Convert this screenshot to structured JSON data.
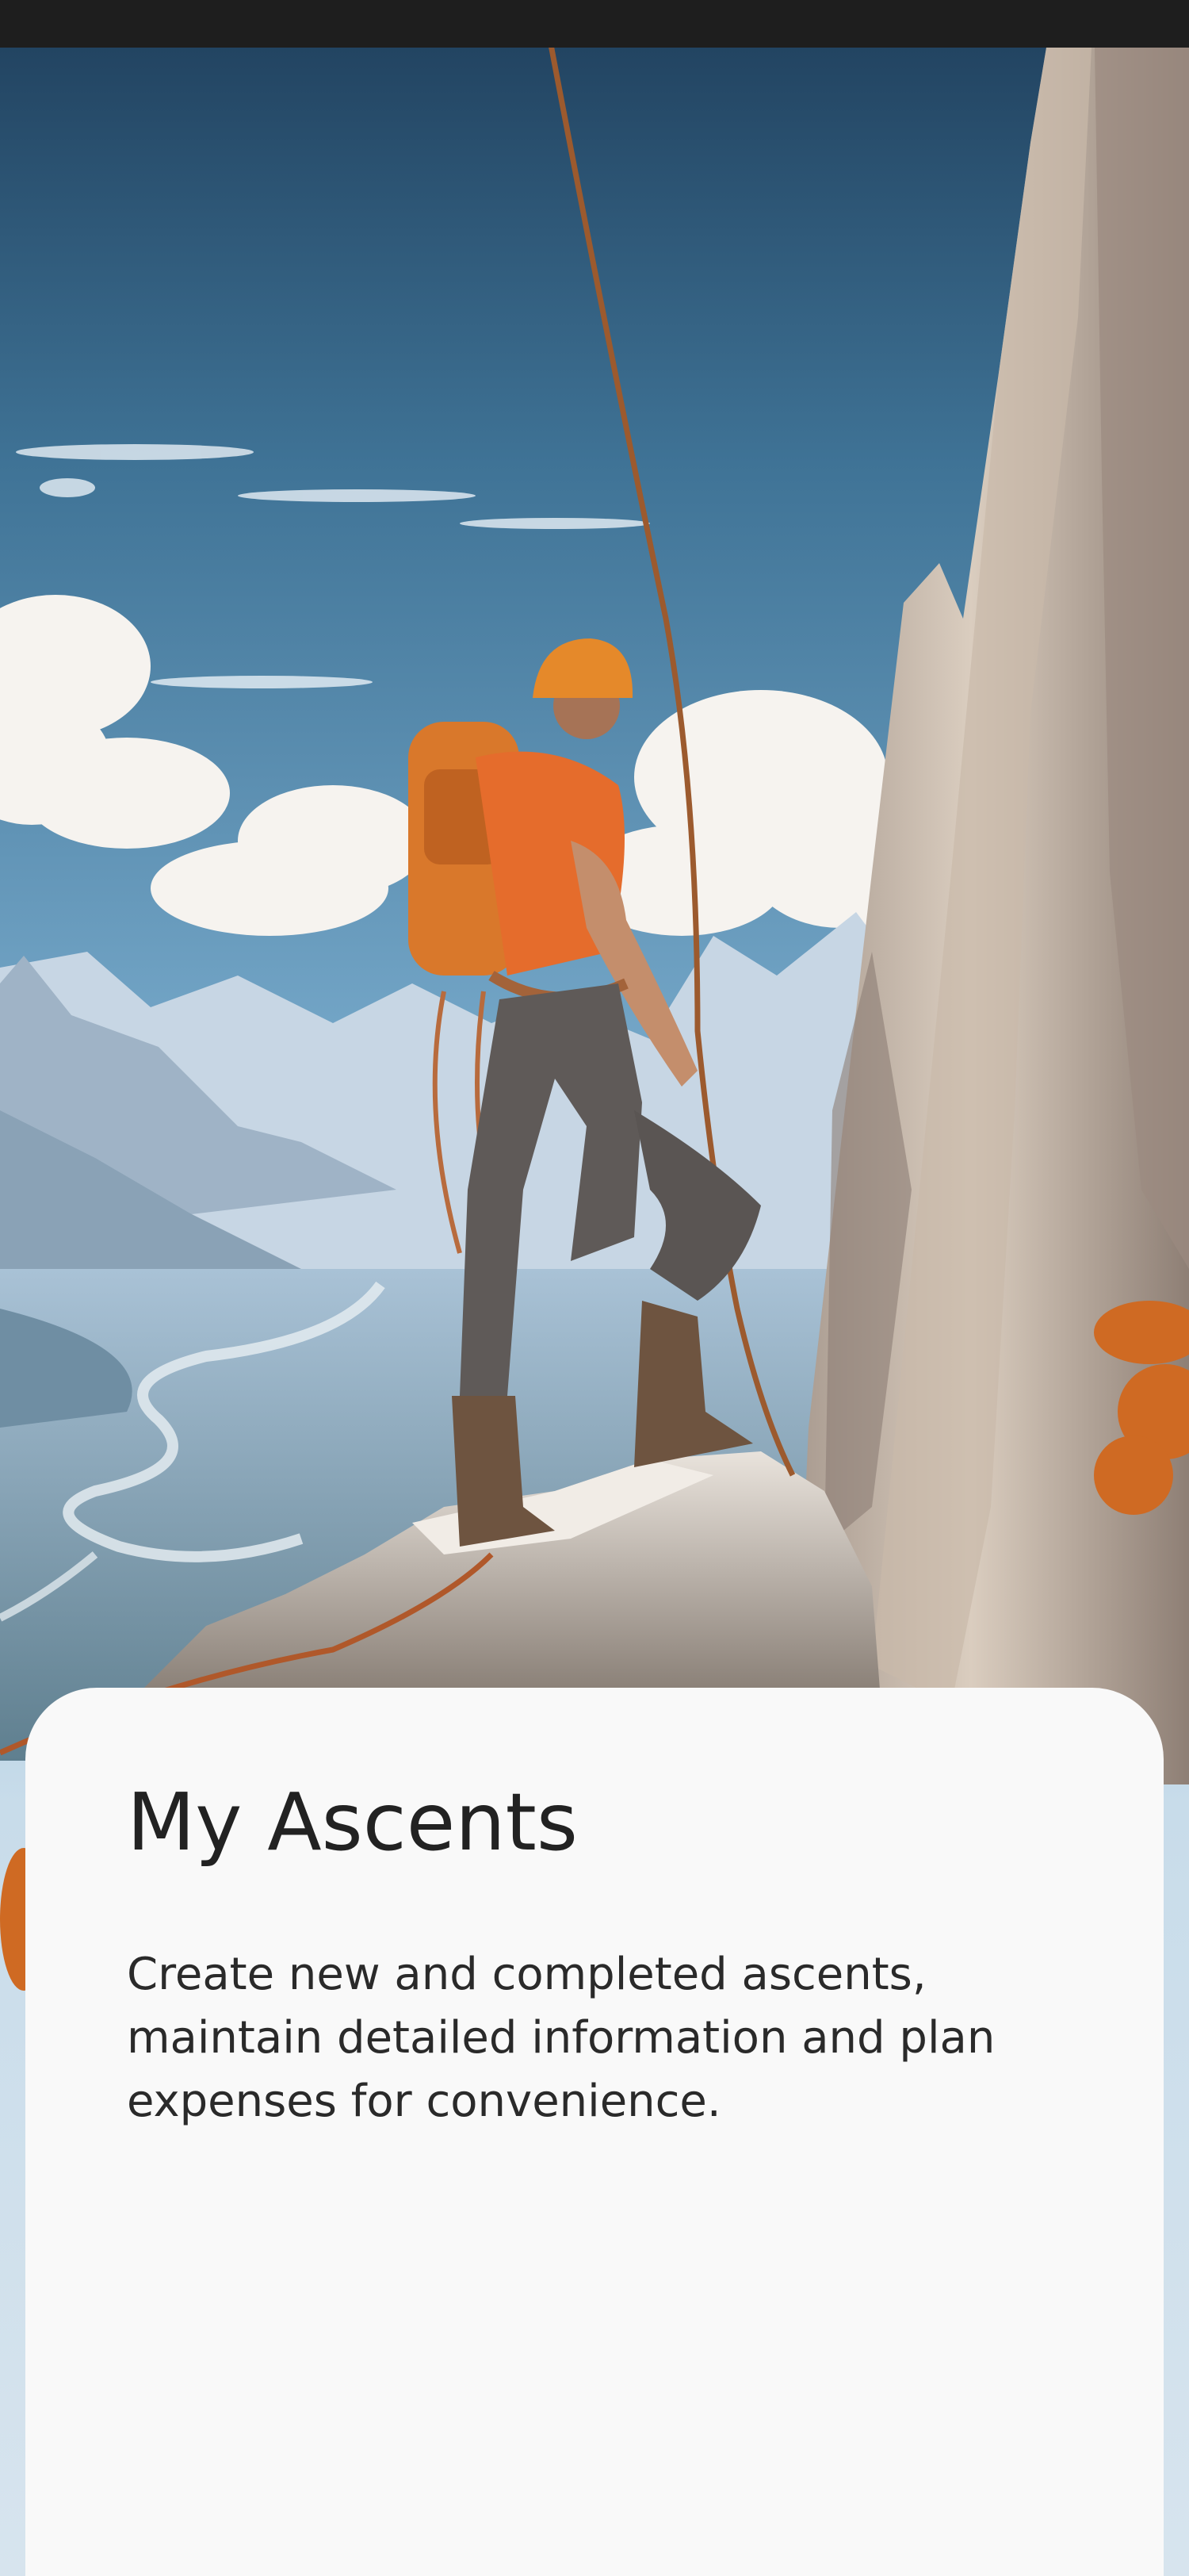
{
  "onboarding": {
    "title": "My Ascents",
    "description": "Create new and completed ascents, maintain detailed information and plan expenses for convenience."
  },
  "hero_image": {
    "subject": "rock-climber-illustration"
  },
  "colors": {
    "sheet_background": "#f9f9f9",
    "title_text": "#222222",
    "body_text": "#2a2a2a",
    "status_bar": "#1e1e1e"
  }
}
